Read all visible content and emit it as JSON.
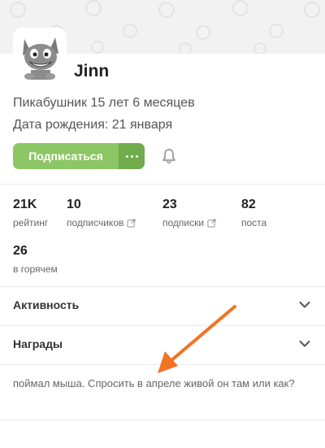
{
  "profile": {
    "username": "Jinn",
    "tenure": "Пикабушник 15 лет 6 месяцев",
    "birthday": "Дата рождения: 21 января",
    "avatar_icon": "cat-avatar-icon"
  },
  "actions": {
    "subscribe_label": "Подписаться",
    "more_icon": "more-dots-icon",
    "bell_icon": "bell-icon",
    "accent_color": "#8dc665"
  },
  "stats": [
    {
      "value": "21K",
      "label": "рейтинг"
    },
    {
      "value": "10",
      "label": "подписчиков",
      "external": true
    },
    {
      "value": "23",
      "label": "подписки",
      "external": true
    },
    {
      "value": "82",
      "label": "поста"
    },
    {
      "value": "26",
      "label": "в горячем"
    }
  ],
  "sections": [
    {
      "title": "Активность"
    },
    {
      "title": "Награды"
    }
  ],
  "bio": "поймал мыша. Спросить в апреле живой он там или как?",
  "annotation": {
    "arrow_color": "#f27323"
  }
}
